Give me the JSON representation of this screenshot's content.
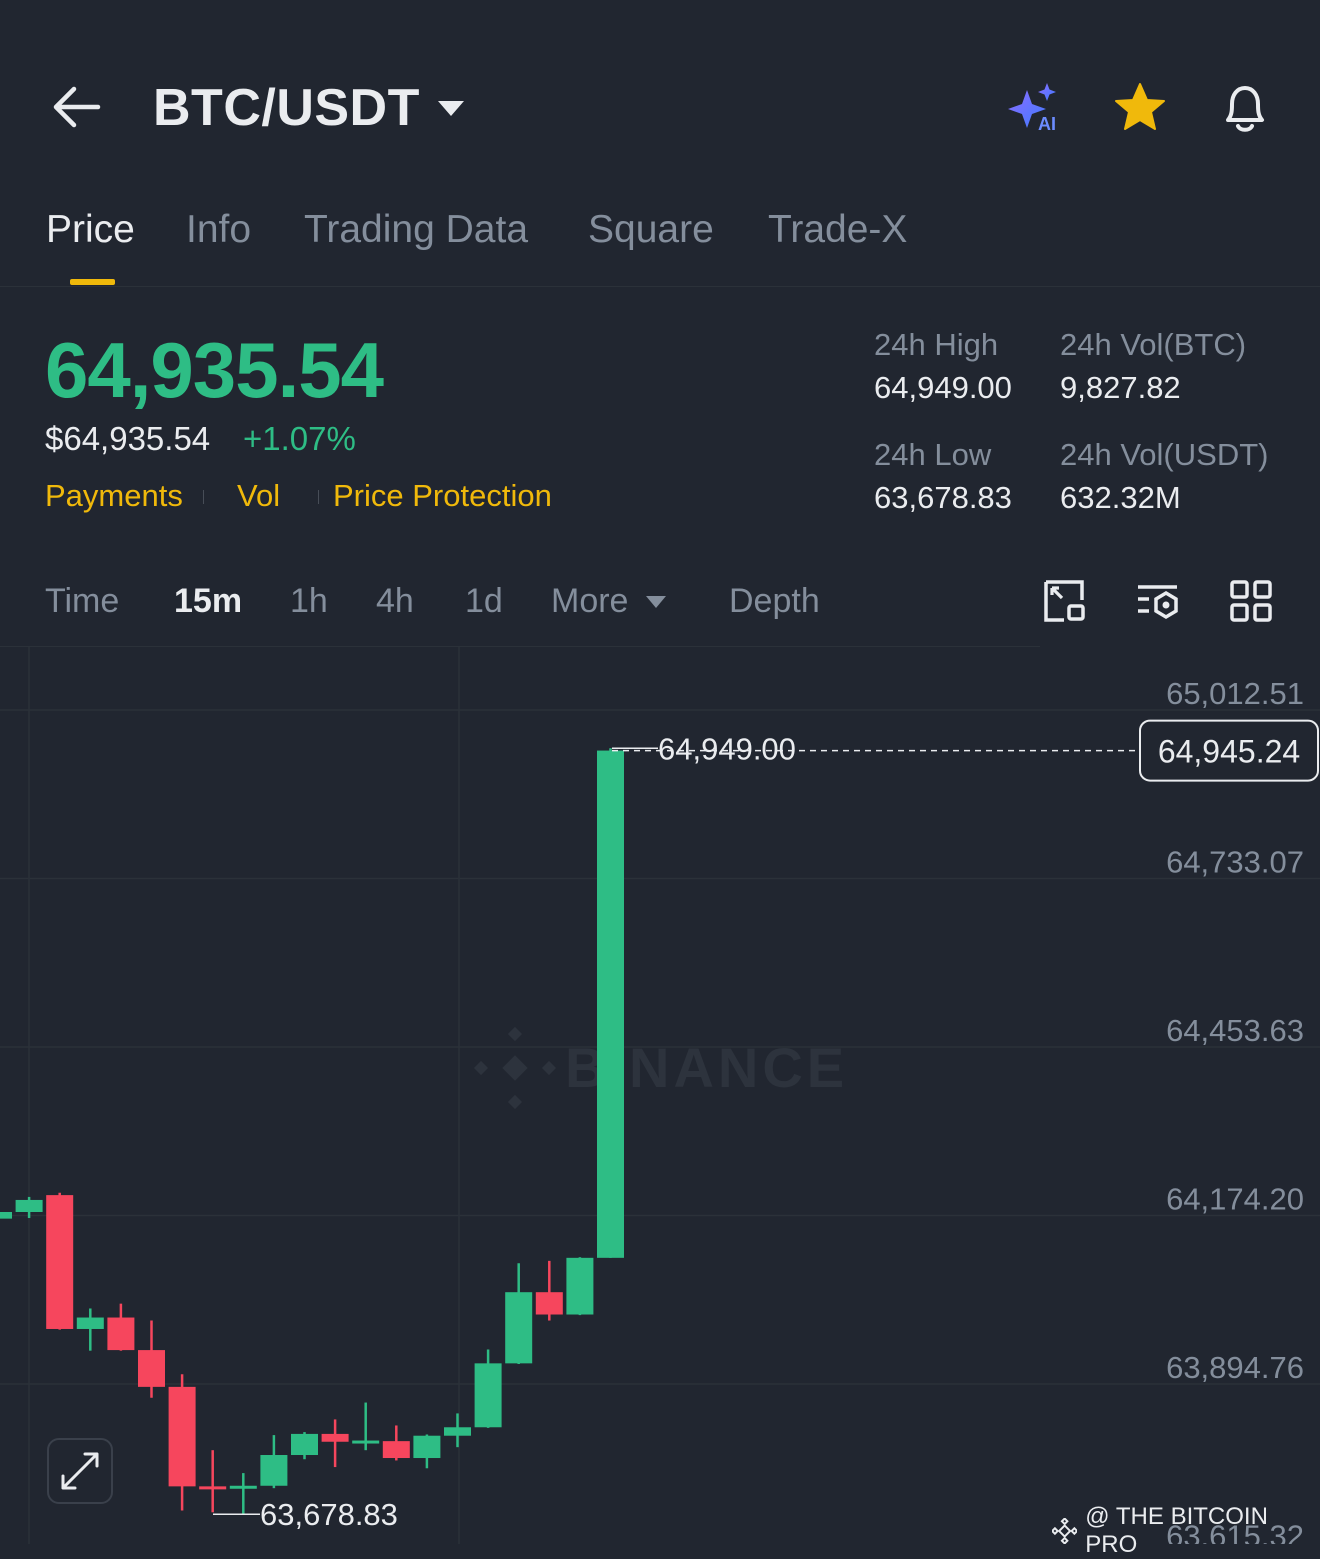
{
  "header": {
    "pair": "BTC/USDT",
    "icons": [
      "back-arrow-icon",
      "ai-sparkle-icon",
      "star-icon",
      "bell-icon"
    ],
    "ai_badge": "AI",
    "accent_color": "#f0b90b"
  },
  "tabs": [
    {
      "label": "Price",
      "active": true
    },
    {
      "label": "Info"
    },
    {
      "label": "Trading Data"
    },
    {
      "label": "Square"
    },
    {
      "label": "Trade-X"
    }
  ],
  "price": {
    "last": "64,935.54",
    "usd": "$64,935.54",
    "change_pct": "+1.07%",
    "tags": [
      "Payments",
      "Vol",
      "Price Protection"
    ],
    "up_color": "#2ebd85",
    "down_color": "#f6465d"
  },
  "stats": {
    "high_label": "24h High",
    "high_value": "64,949.00",
    "low_label": "24h Low",
    "low_value": "63,678.83",
    "vol_btc_label": "24h Vol(BTC)",
    "vol_btc_value": "9,827.82",
    "vol_usdt_label": "24h Vol(USDT)",
    "vol_usdt_value": "632.32M"
  },
  "intervals": {
    "items": [
      "Time",
      "15m",
      "1h",
      "4h",
      "1d",
      "More",
      "Depth"
    ],
    "active": "15m"
  },
  "chart_data": {
    "type": "candlestick",
    "interval": "15m",
    "y_ticks": [
      "65,012.51",
      "64,733.07",
      "64,453.63",
      "64,174.20",
      "63,894.76",
      "63,615.32"
    ],
    "y_tick_values": [
      65012.51,
      64733.07,
      64453.63,
      64174.2,
      63894.76,
      63615.32
    ],
    "current_price_label": "64,945.24",
    "current_price": 64945.24,
    "high_marker_label": "64,949.00",
    "high_marker": 64949.0,
    "low_marker_label": "63,678.83",
    "low_marker": 63678.83,
    "candles": [
      {
        "o": 64169,
        "h": 64190,
        "l": 64140,
        "c": 64180
      },
      {
        "o": 64180,
        "h": 64205,
        "l": 64170,
        "c": 64200
      },
      {
        "o": 64208,
        "h": 64212,
        "l": 63985,
        "c": 63986
      },
      {
        "o": 63986,
        "h": 64020,
        "l": 63950,
        "c": 64005
      },
      {
        "o": 64005,
        "h": 64028,
        "l": 63950,
        "c": 63951
      },
      {
        "o": 63951,
        "h": 64000,
        "l": 63872,
        "c": 63890
      },
      {
        "o": 63890,
        "h": 63911,
        "l": 63685,
        "c": 63725
      },
      {
        "o": 63725,
        "h": 63785,
        "l": 63682,
        "c": 63724
      },
      {
        "o": 63724,
        "h": 63747,
        "l": 63679,
        "c": 63726
      },
      {
        "o": 63726,
        "h": 63810,
        "l": 63722,
        "c": 63777
      },
      {
        "o": 63777,
        "h": 63815,
        "l": 63770,
        "c": 63812
      },
      {
        "o": 63812,
        "h": 63836,
        "l": 63757,
        "c": 63799
      },
      {
        "o": 63799,
        "h": 63864,
        "l": 63785,
        "c": 63801
      },
      {
        "o": 63800,
        "h": 63826,
        "l": 63768,
        "c": 63772
      },
      {
        "o": 63772,
        "h": 63811,
        "l": 63755,
        "c": 63809
      },
      {
        "o": 63809,
        "h": 63846,
        "l": 63790,
        "c": 63823
      },
      {
        "o": 63823,
        "h": 63952,
        "l": 63822,
        "c": 63929
      },
      {
        "o": 63929,
        "h": 64095,
        "l": 63928,
        "c": 64047
      },
      {
        "o": 64047,
        "h": 64099,
        "l": 64000,
        "c": 64010
      },
      {
        "o": 64010,
        "h": 64105,
        "l": 64009,
        "c": 64104
      },
      {
        "o": 64104,
        "h": 64949,
        "l": 64104,
        "c": 64945.24
      }
    ],
    "grid": true,
    "watermark": "BINANCE"
  },
  "watermark_credit": "@ THE BITCOIN PRO"
}
